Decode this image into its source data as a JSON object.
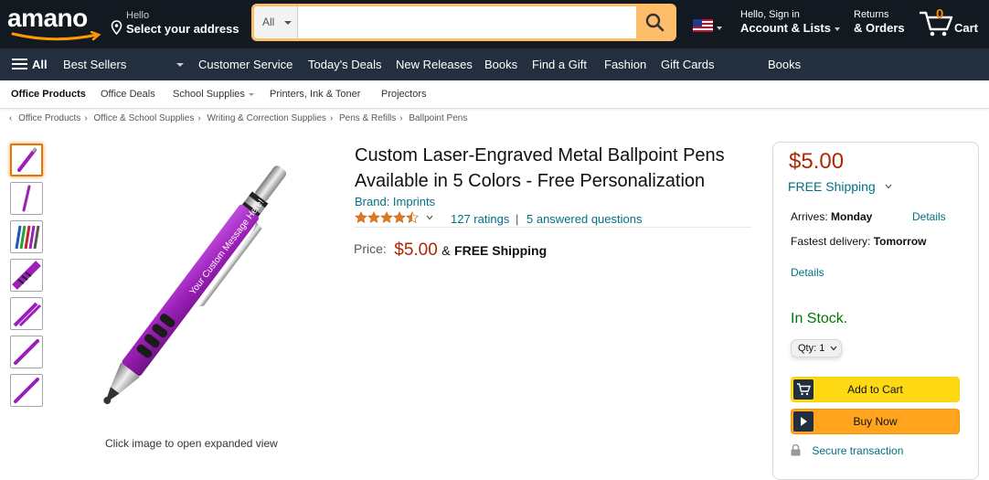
{
  "header": {
    "logo_text": "amano",
    "address_line1": "Hello",
    "address_line2": "Select your address",
    "search": {
      "category": "All",
      "placeholder": "",
      "value": ""
    },
    "account_line1": "Hello, Sign in",
    "account_line2": "Account & Lists",
    "returns_line1": "Returns",
    "returns_line2": "& Orders",
    "cart_count": "0",
    "cart_label": "Cart"
  },
  "nav": {
    "all_label": "All",
    "items": [
      "Best Sellers",
      "Customer Service",
      "Today's Deals",
      "New Releases",
      "Books",
      "Find a Gift",
      "Fashion",
      "Gift Cards",
      "Books"
    ]
  },
  "subnav": {
    "items": [
      "Office Products",
      "Office Deals",
      "School Supplies",
      "Printers, Ink & Toner",
      "Projectors"
    ]
  },
  "breadcrumb": [
    "Office Products",
    "Office & School Supplies",
    "Writing & Correction Supplies",
    "Pens & Refills",
    "Ballpoint Pens"
  ],
  "gallery": {
    "thumbnail_count": 7,
    "selected_index": 0,
    "engraving_text": "Your Custom Message Here!",
    "caption": "Click image to open expanded view"
  },
  "product": {
    "title": "Custom Laser-Engraved Metal Ballpoint Pens Available in 5 Colors - Free Personalization",
    "brand": "Brand: Imprints",
    "rating_stars": 4.5,
    "ratings_text": "127 ratings",
    "separator": "|",
    "questions_text": "5 answered questions",
    "price_label": "Price:",
    "price": "$5.00",
    "price_amp": "&",
    "shipping": "FREE Shipping"
  },
  "buybox": {
    "price": "$5.00",
    "free_shipping": "FREE Shipping",
    "arrives_label": "Arrives:",
    "arrives_day": "Monday",
    "details_label": "Details",
    "fastest_label": "Fastest delivery:",
    "fastest_day": "Tomorrow",
    "details2_label": "Details",
    "stock": "In Stock.",
    "qty_label": "Qty:",
    "qty_value": "1",
    "add_to_cart": "Add to Cart",
    "buy_now": "Buy Now",
    "secure": "Secure transaction"
  },
  "colors": {
    "header_bg": "#131921",
    "nav_bg": "#232f3e",
    "accent": "#febd69",
    "price_red": "#b12704",
    "link": "#007185",
    "in_stock": "#007600",
    "pen_purple": "#9b1fb8"
  }
}
